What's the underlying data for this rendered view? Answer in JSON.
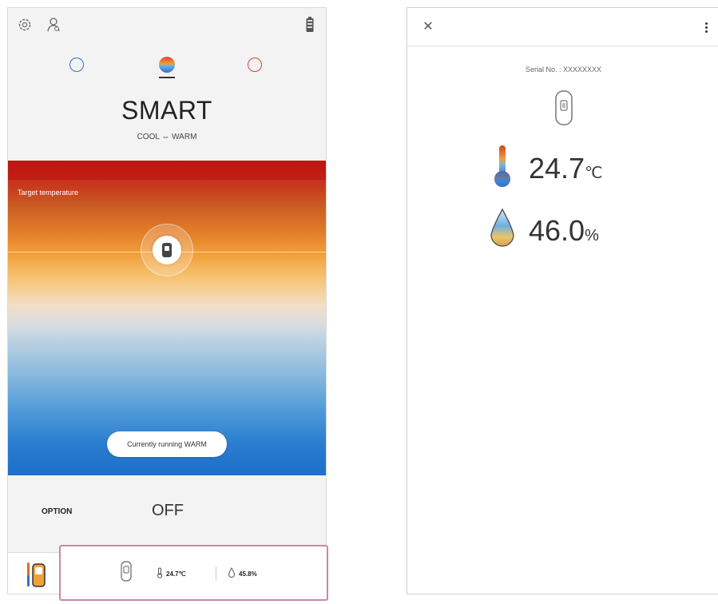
{
  "left_screen": {
    "mode": {
      "title": "SMART",
      "subtitle": "COOL ⇔ WARM"
    },
    "mode_options": [
      {
        "name": "cool",
        "color": "#2f72d2"
      },
      {
        "name": "smart",
        "color": "#e06b2a"
      },
      {
        "name": "warm",
        "color": "#e0413a"
      }
    ],
    "target_label": "Target temperature",
    "status_text": "Currently running WARM",
    "option": {
      "label": "OPTION",
      "value": "OFF"
    },
    "sensor_bar": {
      "temperature": "24.7℃",
      "humidity": "45.8%"
    },
    "icons": [
      "settings-icon",
      "person-icon",
      "battery-icon",
      "sensor-device-icon"
    ]
  },
  "right_screen": {
    "serial": "Serial No. : XXXXXXXX",
    "temperature_value": "24.7",
    "temperature_unit": "℃",
    "humidity_value": "46.0",
    "humidity_unit": "%",
    "icons": [
      "close-icon",
      "more-vert-icon",
      "sensor-device-icon",
      "thermometer-icon",
      "water-drop-icon"
    ]
  },
  "colors": {
    "highlight_border": "#c58aa6",
    "warm": "#cc1a16",
    "cool": "#1e6fc8"
  }
}
